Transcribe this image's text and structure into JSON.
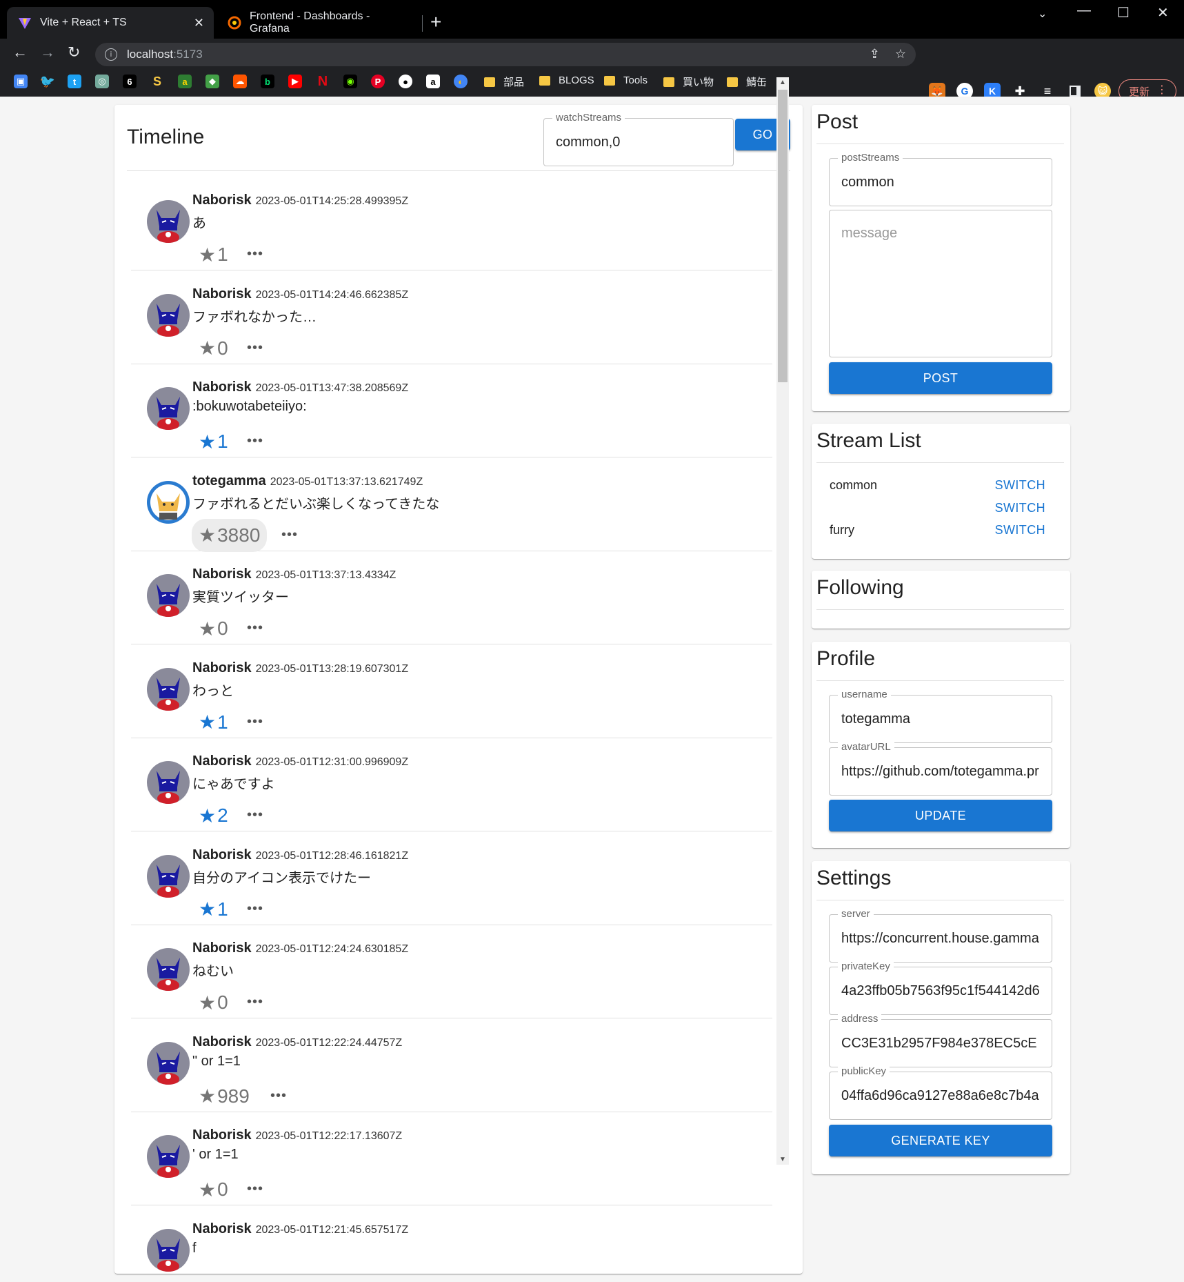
{
  "browser": {
    "tabs": [
      {
        "title": "Vite + React + TS",
        "active": true
      },
      {
        "title": "Frontend - Dashboards - Grafana",
        "active": false
      }
    ],
    "url_host": "localhost",
    "url_port": ":5173",
    "update_label": "更新",
    "bookmarks": [
      "部品",
      "BLOGS",
      "Tools",
      "買い物",
      "鯖缶"
    ]
  },
  "timeline": {
    "title": "Timeline",
    "watch_label": "watchStreams",
    "watch_value": "common,0",
    "go_label": "GO",
    "posts": [
      {
        "user": "Naborisk",
        "time": "2023-05-01T14:25:28.499395Z",
        "text": "あ",
        "favs": "1",
        "faved": false,
        "avatar": "naborisk"
      },
      {
        "user": "Naborisk",
        "time": "2023-05-01T14:24:46.662385Z",
        "text": "ファボれなかった…",
        "favs": "0",
        "faved": false,
        "avatar": "naborisk"
      },
      {
        "user": "Naborisk",
        "time": "2023-05-01T13:47:38.208569Z",
        "text": ":bokuwotabeteiiyo:",
        "favs": "1",
        "faved": true,
        "avatar": "naborisk"
      },
      {
        "user": "totegamma",
        "time": "2023-05-01T13:37:13.621749Z",
        "text": "ファボれるとだいぶ楽しくなってきたな",
        "favs": "3880",
        "faved": false,
        "avatar": "totegamma"
      },
      {
        "user": "Naborisk",
        "time": "2023-05-01T13:37:13.4334Z",
        "text": "実質ツイッター",
        "favs": "0",
        "faved": false,
        "avatar": "naborisk"
      },
      {
        "user": "Naborisk",
        "time": "2023-05-01T13:28:19.607301Z",
        "text": "わっと",
        "favs": "1",
        "faved": true,
        "avatar": "naborisk"
      },
      {
        "user": "Naborisk",
        "time": "2023-05-01T12:31:00.996909Z",
        "text": "にゃあですよ",
        "favs": "2",
        "faved": true,
        "avatar": "naborisk"
      },
      {
        "user": "Naborisk",
        "time": "2023-05-01T12:28:46.161821Z",
        "text": "自分のアイコン表示でけたー",
        "favs": "1",
        "faved": true,
        "avatar": "naborisk"
      },
      {
        "user": "Naborisk",
        "time": "2023-05-01T12:24:24.630185Z",
        "text": "ねむい",
        "favs": "0",
        "faved": false,
        "avatar": "naborisk"
      },
      {
        "user": "Naborisk",
        "time": "2023-05-01T12:22:24.44757Z",
        "text": "\" or 1=1",
        "favs": "989",
        "faved": false,
        "avatar": "naborisk"
      },
      {
        "user": "Naborisk",
        "time": "2023-05-01T12:22:17.13607Z",
        "text": "' or 1=1",
        "favs": "0",
        "faved": false,
        "avatar": "naborisk"
      },
      {
        "user": "Naborisk",
        "time": "2023-05-01T12:21:45.657517Z",
        "text": "f",
        "favs": "",
        "faved": false,
        "avatar": "naborisk"
      }
    ]
  },
  "post": {
    "title": "Post",
    "streams_label": "postStreams",
    "streams_value": "common",
    "message_placeholder": "message",
    "button": "POST"
  },
  "stream_list": {
    "title": "Stream List",
    "items": [
      {
        "name": "common",
        "action": "SWITCH"
      },
      {
        "name": "",
        "action": "SWITCH"
      },
      {
        "name": "furry",
        "action": "SWITCH"
      }
    ]
  },
  "following": {
    "title": "Following"
  },
  "profile": {
    "title": "Profile",
    "username_label": "username",
    "username_value": "totegamma",
    "avatar_label": "avatarURL",
    "avatar_value": "https://github.com/totegamma.pr",
    "button": "UPDATE"
  },
  "settings": {
    "title": "Settings",
    "server_label": "server",
    "server_value": "https://concurrent.house.gamma",
    "privkey_label": "privateKey",
    "privkey_value": "4a23ffb05b7563f95c1f544142d6",
    "address_label": "address",
    "address_value": "CC3E31b2957F984e378EC5cE",
    "pubkey_label": "publicKey",
    "pubkey_value": "04ffa6d96ca9127e88a6e8c7b4a",
    "button": "GENERATE KEY"
  },
  "colors": {
    "primary": "#1976d2",
    "chrome_bg": "#202124",
    "page_bg": "#f5f5f5"
  }
}
